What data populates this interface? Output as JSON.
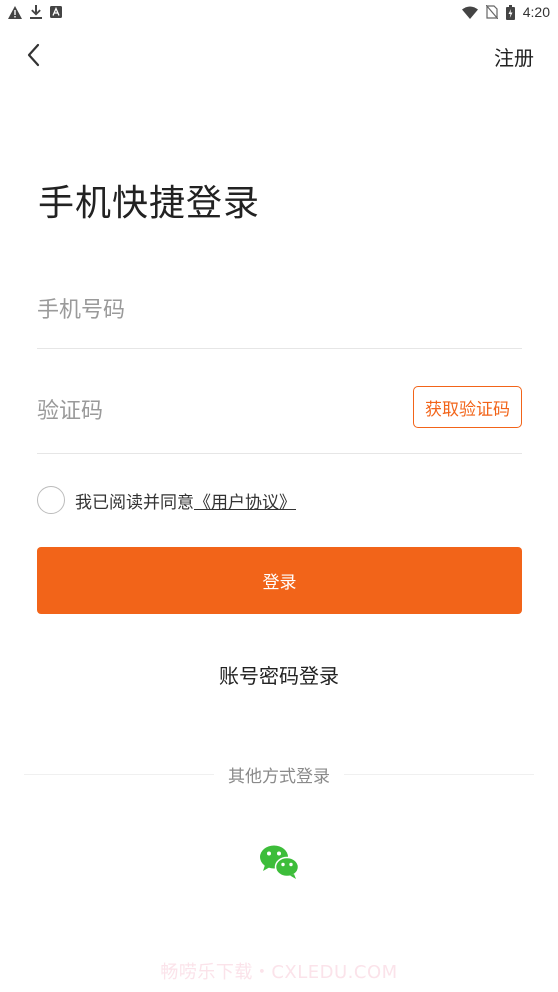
{
  "status_bar": {
    "time": "4:20",
    "left_icons": [
      "warning-icon",
      "download-icon",
      "notification-a-icon"
    ],
    "right_icons": [
      "wifi-icon",
      "no-sim-icon",
      "battery-icon"
    ]
  },
  "nav": {
    "back_icon": "chevron-left-icon",
    "register_label": "注册"
  },
  "title": "手机快捷登录",
  "form": {
    "phone_placeholder": "手机号码",
    "phone_value": "",
    "code_placeholder": "验证码",
    "code_value": "",
    "get_code_label": "获取验证码"
  },
  "agreement": {
    "text": "我已阅读并同意",
    "link_label": "《用户协议》",
    "checked": false
  },
  "login_button_label": "登录",
  "password_login_label": "账号密码登录",
  "other_login_label": "其他方式登录",
  "other_login_icons": [
    "wechat-icon"
  ],
  "watermark": "畅唠乐下载・CXLEDU.COM",
  "colors": {
    "accent": "#f26419",
    "wechat": "#3dbd3a"
  }
}
